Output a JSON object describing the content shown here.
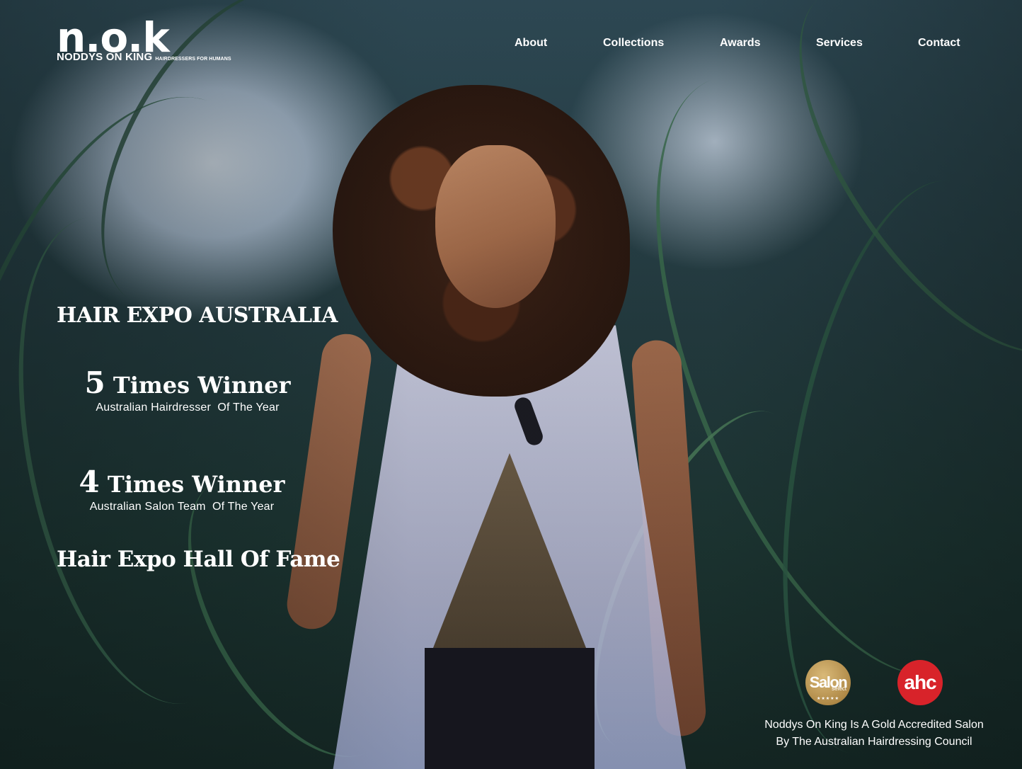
{
  "header": {
    "logo_mark": "n.o.k",
    "logo_name": "NODDYS ON KING",
    "logo_tagline": "HAIRDRESSERS FOR HUMANS"
  },
  "nav": {
    "items": [
      {
        "label": "About"
      },
      {
        "label": "Collections"
      },
      {
        "label": "Awards"
      },
      {
        "label": "Services"
      },
      {
        "label": "Contact"
      }
    ]
  },
  "awards": {
    "title": "HAIR EXPO AUSTRALIA",
    "wins": [
      {
        "count": "5",
        "label": "Times Winner",
        "subtitle": "Australian Hairdresser  Of The Year"
      },
      {
        "count": "4",
        "label": "Times Winner",
        "subtitle": "Australian Salon Team  Of The Year"
      }
    ],
    "hall_of_fame": "Hair Expo Hall Of Fame"
  },
  "accreditation": {
    "badges": [
      {
        "icon": "salon-select-badge-icon",
        "text": "Salon",
        "subtext": "select",
        "stars": "★★★★★"
      },
      {
        "icon": "ahc-badge-icon",
        "text": "ahc"
      }
    ],
    "line1": "Noddys On King Is A Gold Accredited Salon",
    "line2": "By The Australian Hairdressing Council"
  },
  "colors": {
    "text": "#ffffff",
    "salon_badge_gold": "#b08a48",
    "ahc_badge_red": "#d8232a"
  }
}
